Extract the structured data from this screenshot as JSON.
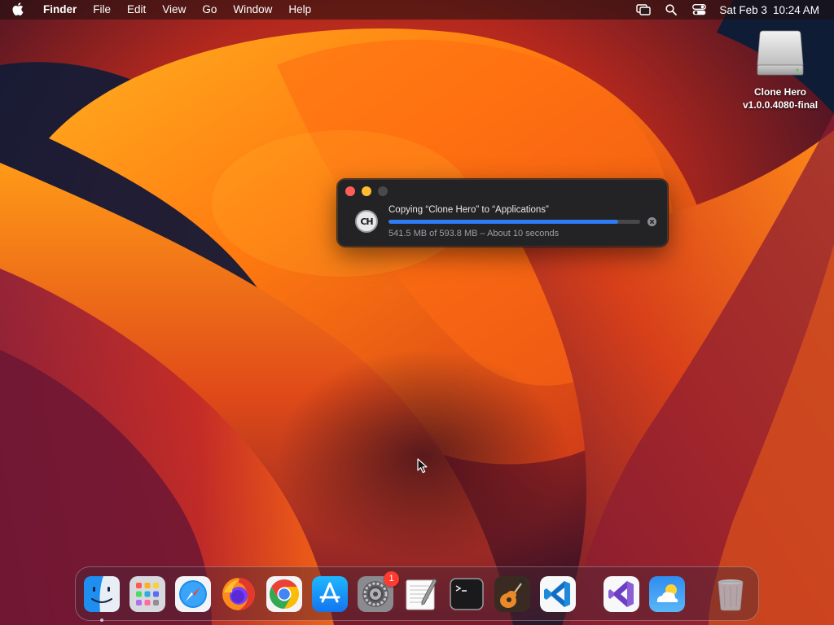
{
  "menubar": {
    "apple_icon": "apple-logo-icon",
    "app_name": "Finder",
    "menus": [
      "File",
      "Edit",
      "View",
      "Go",
      "Window",
      "Help"
    ],
    "status_icons": [
      "screen-mirroring-icon",
      "spotlight-search-icon",
      "control-center-icon"
    ],
    "date": "Sat Feb 3",
    "time": "10:24 AM"
  },
  "desktop": {
    "items": [
      {
        "label_line1": "Clone Hero",
        "label_line2": "v1.0.0.4080-final",
        "icon": "external-drive-icon"
      }
    ]
  },
  "copy_dialog": {
    "app_icon_text": "CH",
    "title": "Copying “Clone Hero” to “Applications”",
    "progress_fraction": 0.912,
    "detail": "541.5 MB of 593.8 MB – About 10 seconds",
    "colors": {
      "progress": "#2f7bf6",
      "close": "#ff5f57",
      "minimize": "#febc2e"
    }
  },
  "dock": {
    "apps": [
      {
        "name": "Finder",
        "icon": "finder-icon",
        "running": true
      },
      {
        "name": "Launchpad",
        "icon": "launchpad-icon"
      },
      {
        "name": "Safari",
        "icon": "safari-icon"
      },
      {
        "name": "Firefox",
        "icon": "firefox-icon"
      },
      {
        "name": "Google Chrome",
        "icon": "chrome-icon"
      },
      {
        "name": "App Store",
        "icon": "app-store-icon"
      },
      {
        "name": "System Settings",
        "icon": "system-settings-icon",
        "badge": "1"
      },
      {
        "name": "TextEdit",
        "icon": "textedit-icon"
      },
      {
        "name": "Terminal",
        "icon": "terminal-icon"
      },
      {
        "name": "GarageBand",
        "icon": "garageband-icon"
      },
      {
        "name": "Visual Studio Code",
        "icon": "vscode-icon"
      }
    ],
    "recent_apps": [
      {
        "name": "Visual Studio",
        "icon": "visual-studio-icon"
      },
      {
        "name": "Weather",
        "icon": "weather-icon"
      }
    ],
    "trash": {
      "name": "Trash",
      "icon": "trash-icon"
    }
  }
}
